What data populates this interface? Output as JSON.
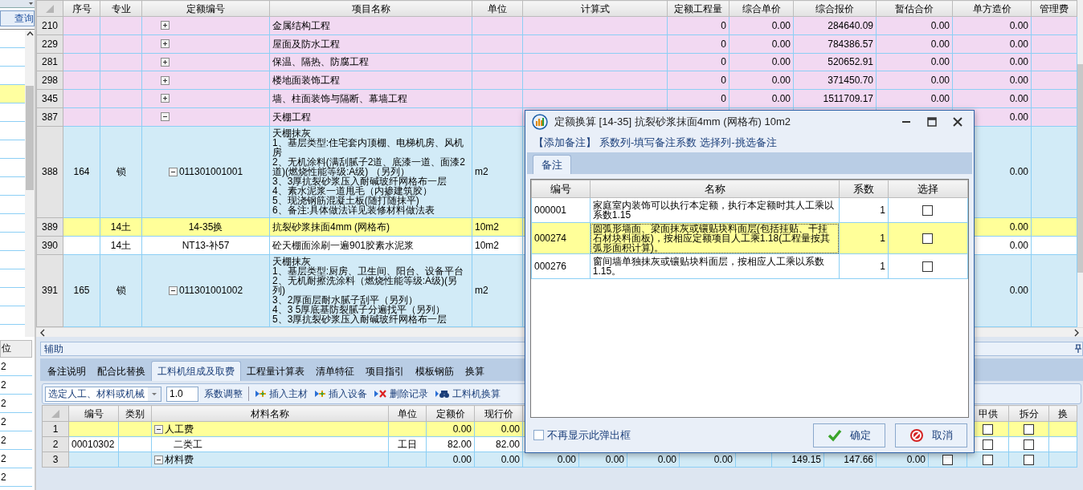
{
  "left_panel": {
    "query_button": "查询",
    "rows": [
      {
        "selected": false
      },
      {
        "selected": false
      },
      {
        "selected": false
      },
      {
        "selected": true
      },
      {
        "selected": false
      },
      {
        "selected": false
      },
      {
        "selected": false
      },
      {
        "selected": false
      },
      {
        "selected": false
      },
      {
        "selected": false
      },
      {
        "selected": false
      },
      {
        "selected": false
      },
      {
        "selected": false
      },
      {
        "selected": false
      },
      {
        "selected": false
      },
      {
        "selected": false
      }
    ]
  },
  "left_lower": {
    "header": "位",
    "cells": [
      "2",
      "2",
      "2",
      "2",
      "2",
      "2",
      "2"
    ]
  },
  "main_grid": {
    "columns": [
      "序号",
      "专业",
      "定额编号",
      "项目名称",
      "单位",
      "计算式",
      "定额工程量",
      "综合单价",
      "综合报价",
      "暂估合价",
      "单方造价",
      "管理费"
    ],
    "rows": [
      {
        "kind": "division",
        "num": "210",
        "expanded": false,
        "name": "金属结构工程",
        "quantity": "0",
        "unit_price": "0.00",
        "total": "284640.09",
        "estimate": "0.00",
        "unit_cost": "0.00",
        "selected": false
      },
      {
        "kind": "division",
        "num": "229",
        "expanded": false,
        "name": "屋面及防水工程",
        "quantity": "0",
        "unit_price": "0.00",
        "total": "784386.57",
        "estimate": "0.00",
        "unit_cost": "0.00",
        "selected": false
      },
      {
        "kind": "division",
        "num": "281",
        "expanded": false,
        "name": "保温、隔热、防腐工程",
        "quantity": "0",
        "unit_price": "0.00",
        "total": "520652.91",
        "estimate": "0.00",
        "unit_cost": "0.00",
        "selected": false
      },
      {
        "kind": "division",
        "num": "298",
        "expanded": false,
        "name": "楼地面装饰工程",
        "quantity": "0",
        "unit_price": "0.00",
        "total": "371450.70",
        "estimate": "0.00",
        "unit_cost": "0.00",
        "selected": false
      },
      {
        "kind": "division",
        "num": "345",
        "expanded": false,
        "name": "墙、柱面装饰与隔断、幕墙工程",
        "quantity": "0",
        "unit_price": "0.00",
        "total": "1511709.17",
        "estimate": "0.00",
        "unit_cost": "0.00",
        "selected": false
      },
      {
        "kind": "division",
        "num": "387",
        "expanded": true,
        "name": "天棚工程",
        "unit_cost": "0.00",
        "selected": false
      },
      {
        "kind": "bill",
        "num": "388",
        "seq": "164",
        "major": "锁",
        "expanded": true,
        "code": "011301001001",
        "name_lines": [
          "天棚抹灰",
          "1、基层类型:住宅套内顶棚、电梯机房、风机房",
          "2、无机涂料(满刮腻子2道、底漆一道、面漆2道)(燃烧性能等级:A级) （另列）",
          "3、3厚抗裂砂浆压入耐碱玻纤网格布一层",
          "4、素水泥浆一道甩毛（内掺建筑胶）",
          "5、现浇钢筋混凝土板(随打随抹平)",
          "6、备注:具体做法详见装修材料做法表"
        ],
        "unit": "m2",
        "unit_cost": "0.00",
        "selected": false
      },
      {
        "kind": "quota",
        "num": "389",
        "major": "14土",
        "code": "14-35换",
        "name": "抗裂砂浆抹面4mm (网格布)",
        "unit": "10m2",
        "unit_cost": "0.00",
        "selected": true
      },
      {
        "kind": "quota",
        "num": "390",
        "major": "14土",
        "code": "NT13-补57",
        "name": "砼天棚面涂刷一遍901胶素水泥浆",
        "unit": "10m2",
        "unit_cost": "0.00",
        "selected": false
      },
      {
        "kind": "bill",
        "num": "391",
        "seq": "165",
        "major": "锁",
        "expanded": true,
        "code": "011301001002",
        "name_lines": [
          "天棚抹灰",
          "1、基层类型:厨房、卫生间、阳台、设备平台",
          "2、无机耐擦洗涂料（燃烧性能等级:A级)(另列)",
          "3、2厚面层耐水腻子刮平（另列）",
          "4、3 5厚底基防裂腻子分遍找平（另列）",
          "5、3厚抗裂砂浆压入耐碱玻纤网格布一层"
        ],
        "unit": "m2",
        "unit_cost": "0.00",
        "selected": false
      }
    ]
  },
  "aux_panel": {
    "title": "辅助",
    "tabs": [
      {
        "label": "备注说明",
        "selected": false
      },
      {
        "label": "配合比替换",
        "selected": false
      },
      {
        "label": "工料机组成及取费",
        "selected": true
      },
      {
        "label": "工程量计算表",
        "selected": false
      },
      {
        "label": "清单特征",
        "selected": false
      },
      {
        "label": "项目指引",
        "selected": false
      },
      {
        "label": "模板钢筋",
        "selected": false
      },
      {
        "label": "换算",
        "selected": false
      }
    ],
    "toolbar": {
      "select_value": "选定人工、材料或机械",
      "factor_value": "1.0",
      "buttons": [
        {
          "label": "系数调整",
          "kind": "plain"
        },
        {
          "label": "插入主材",
          "kind": "insert"
        },
        {
          "label": "插入设备",
          "kind": "insert"
        },
        {
          "label": "删除记录",
          "kind": "delete"
        },
        {
          "label": "工料机换算",
          "kind": "convert"
        }
      ]
    },
    "grid": {
      "columns_left": [
        "编号",
        "类别",
        "材料名称",
        "单位",
        "定额价",
        "现行价"
      ],
      "columns_right": [
        "甲供",
        "拆分",
        "换"
      ],
      "rows": [
        {
          "num": "1",
          "kind": "category",
          "selected": true,
          "expanded": true,
          "name": "人工费",
          "base_price": "0.00",
          "current_price": "0.00",
          "supply": {
            "checked": false
          },
          "split": {
            "checked": false
          }
        },
        {
          "num": "2",
          "kind": "item",
          "selected": false,
          "code": "00010302",
          "name": "二类工",
          "unit": "工日",
          "base_price": "82.00",
          "current_price": "82.00",
          "supply": {
            "checked": false
          },
          "split": {
            "checked": false
          }
        },
        {
          "num": "3",
          "kind": "category",
          "selected": false,
          "expanded": true,
          "name": "材料费",
          "base_price": "0.00",
          "current_price": "0.00",
          "middle_a": [
            "0.00",
            "0.00",
            "0.00",
            "0.00"
          ],
          "middle_b": [
            "149.15",
            "147.66",
            "0.00"
          ],
          "extra": {
            "checked": false
          },
          "supply": {
            "checked": false
          },
          "split": {
            "checked": false
          }
        }
      ]
    }
  },
  "dialog": {
    "title": "定额换算 [14-35] 抗裂砂浆抹面4mm (网格布) 10m2",
    "links": [
      "【添加备注】",
      "系数列-填写备注系数",
      "选择列-挑选备注"
    ],
    "tabs": [
      {
        "label": "备注",
        "selected": true
      }
    ],
    "columns": [
      "编号",
      "名称",
      "系数",
      "选择"
    ],
    "rows": [
      {
        "code": "000001",
        "name": "家庭室内装饰可以执行本定额，执行本定额时其人工乘以系数1.15",
        "factor": "1",
        "checked": false,
        "selected": false
      },
      {
        "code": "000274",
        "name": "圆弧形墙面、梁面抹灰或镶贴块料面层(包括挂贴、干挂石材块料面板)，按相应定额项目人工乘1.18(工程量按其弧形面积计算)。",
        "factor": "1",
        "checked": false,
        "selected": true
      },
      {
        "code": "000276",
        "name": "窗间墙单独抹灰或镶贴块料面层，按相应人工乘以系数1.15。",
        "factor": "1",
        "checked": false,
        "selected": false
      }
    ],
    "dont_show": {
      "label": "不再显示此弹出框",
      "checked": false
    },
    "ok_button": "确定",
    "cancel_button": "取消"
  }
}
